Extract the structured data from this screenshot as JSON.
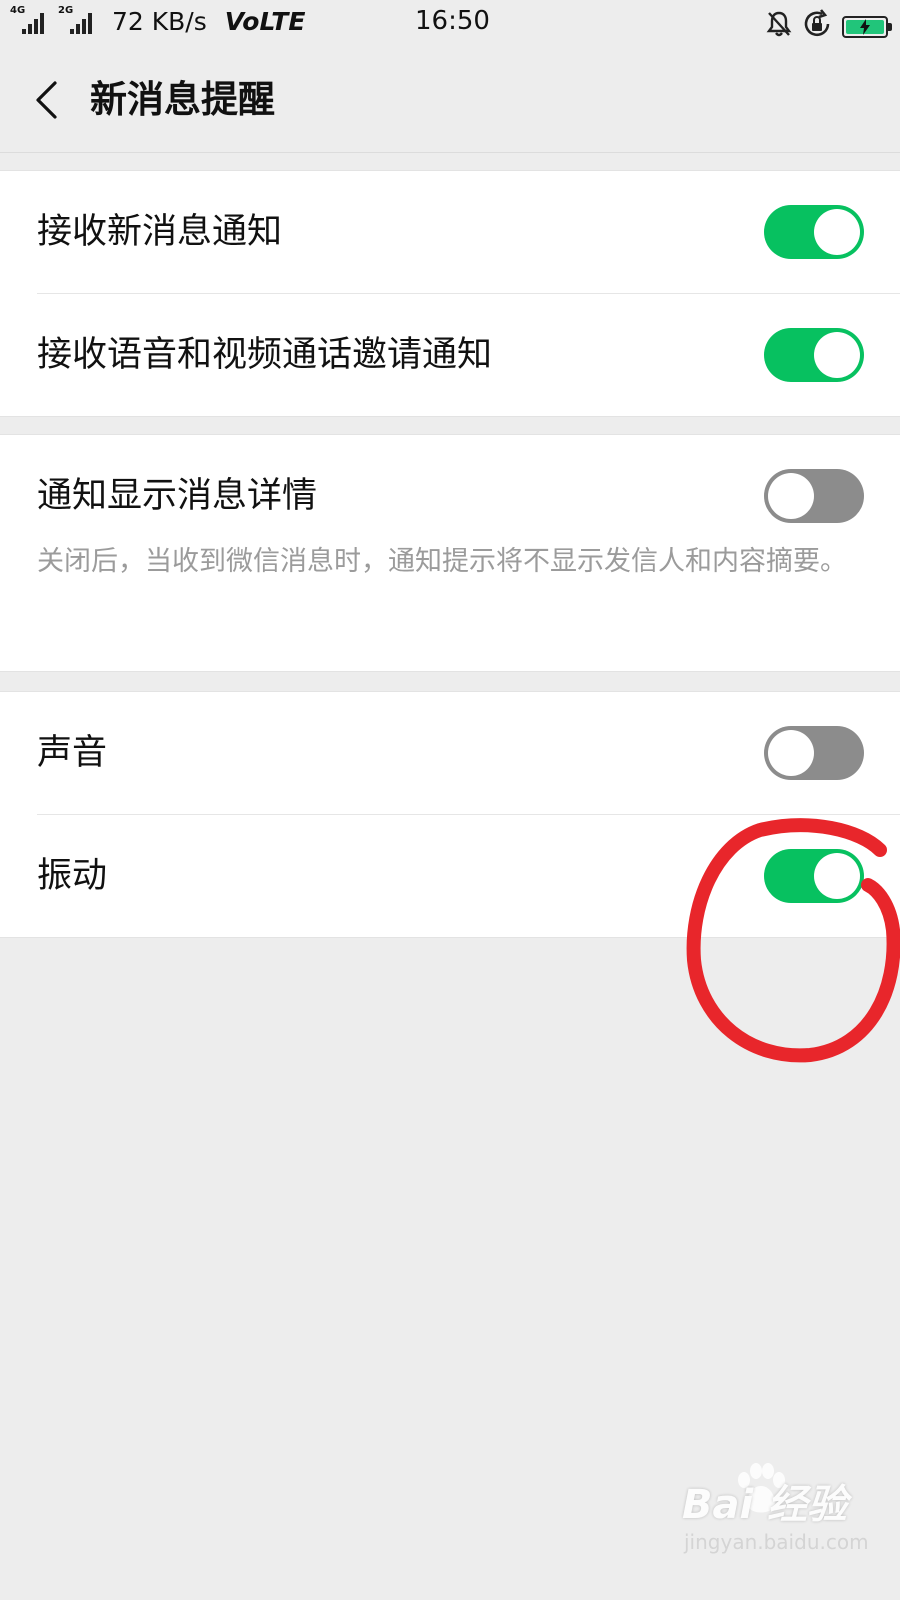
{
  "status_bar": {
    "sim1_network": "4G",
    "sim2_network": "2G",
    "net_speed": "72 KB/s",
    "volte": "VoLTE",
    "time": "16:50",
    "icons": [
      "silent-bell-icon",
      "rotation-lock-icon",
      "battery-charging-icon"
    ],
    "battery_color": "#21c57a"
  },
  "nav": {
    "title": "新消息提醒",
    "back_icon": "chevron-left-icon"
  },
  "settings": {
    "receive_new_message": {
      "label": "接收新消息通知",
      "enabled": true
    },
    "receive_call_invite": {
      "label": "接收语音和视频通话邀请通知",
      "enabled": true
    },
    "show_details": {
      "label": "通知显示消息详情",
      "enabled": false,
      "hint": "关闭后，当收到微信消息时，通知提示将不显示发信人和内容摘要。"
    },
    "sound": {
      "label": "声音",
      "enabled": false
    },
    "vibrate": {
      "label": "振动",
      "enabled": true
    }
  },
  "colors": {
    "toggle_on": "#07c160",
    "toggle_off": "#8c8c8c",
    "annotation": "#e8262b"
  },
  "watermark": {
    "brand": "Bai  经验",
    "url": "jingyan.baidu.com"
  }
}
